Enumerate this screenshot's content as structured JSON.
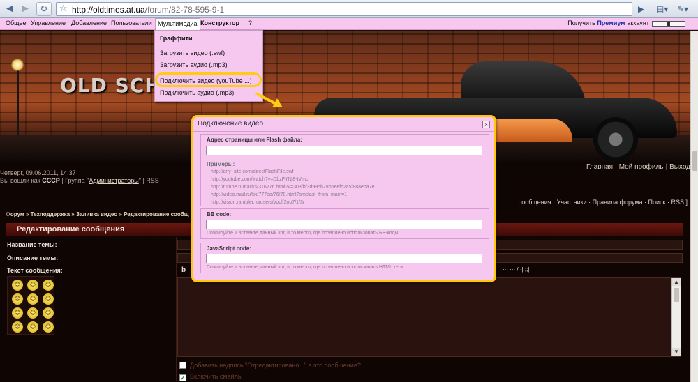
{
  "browser": {
    "url_host": "http://oldtimes.at.ua",
    "url_path": "/forum/82-78-595-9-1",
    "icons": [
      "back-icon",
      "forward-icon",
      "reload-icon",
      "star-icon",
      "play-icon",
      "page-icon",
      "wrench-icon"
    ]
  },
  "menubar": {
    "items": [
      "Общее",
      "Управление",
      "Добавление",
      "Пользователи",
      "Мультимедиа",
      "Конструктор",
      "?"
    ],
    "premium_prefix": "Получить",
    "premium_word": "Премиум",
    "premium_suffix": "аккаунт"
  },
  "dropdown": {
    "header": "Граффити",
    "items": [
      "Загрузить видео (.swf)",
      "Загрузить аудио (.mp3)",
      "Подключить видео (youTube ...)",
      "Подключить аудио (.mp3)"
    ],
    "highlighted_index": 2
  },
  "banner": {
    "text": "OLD SCHO          RODS"
  },
  "page": {
    "datetime": "Четверг, 09.06.2011, 14:37",
    "logged_prefix": "Вы вошли как",
    "user": "СССР",
    "group_prefix": "| Группа \"",
    "group": "Администраторы",
    "group_suffix": "\" | RSS",
    "top_links": [
      "Главная",
      "Мой профиль",
      "Выход"
    ],
    "breadcrumb": "Форум » Техподдержка » Заливка видео » Редактирование сообщ",
    "forum_links": "сообщения · Участники · Правила форума · Поиск · RSS ]",
    "edit_header": "Редактирование сообщения",
    "label_title": "Название темы:",
    "label_desc": "Описание темы:",
    "label_text": "Текст сообщения:",
    "toolbar_bold": "b",
    "toolbar_right": "···  ···  /  ·|  ;;|",
    "checkbox1": "Добавить надпись \"Отредактировано...\" в это сообщение?",
    "checkbox2": "Включить смайлы",
    "smileys": [
      "☺",
      "☺",
      "☺",
      "☹",
      "☺",
      "☺",
      "☺",
      "☺",
      "☺",
      "☹",
      "☺",
      "☺"
    ]
  },
  "dialog": {
    "title": "Подключение видео",
    "close": "x",
    "url_legend": "Адрес страницы или Flash файла:",
    "examples_title": "Примеры:",
    "examples": [
      "http://any_site.com/directFlashFile.swf",
      "http://youtube.com/watch?v=DbzFYNj8-tVmc",
      "http://rutube.ru/tracks/316276.html?v=303fbf3d995b79b6eefc2a5f88aeba7e",
      "http://video.mail.ru/bk/777da/76/78.html?smclast_from_main=1",
      "http://vision.rambler.ru/users/voolf2oo7/1/3/"
    ],
    "bb_legend": "BB code:",
    "bb_hint": "Скопируйте и вставьте данный код в то место, где позволено использовать ББ-коды.",
    "js_legend": "JavaScript code:",
    "js_hint": "Скопируйте и вставьте данный код в то место, где позволено использовать HTML теги."
  }
}
